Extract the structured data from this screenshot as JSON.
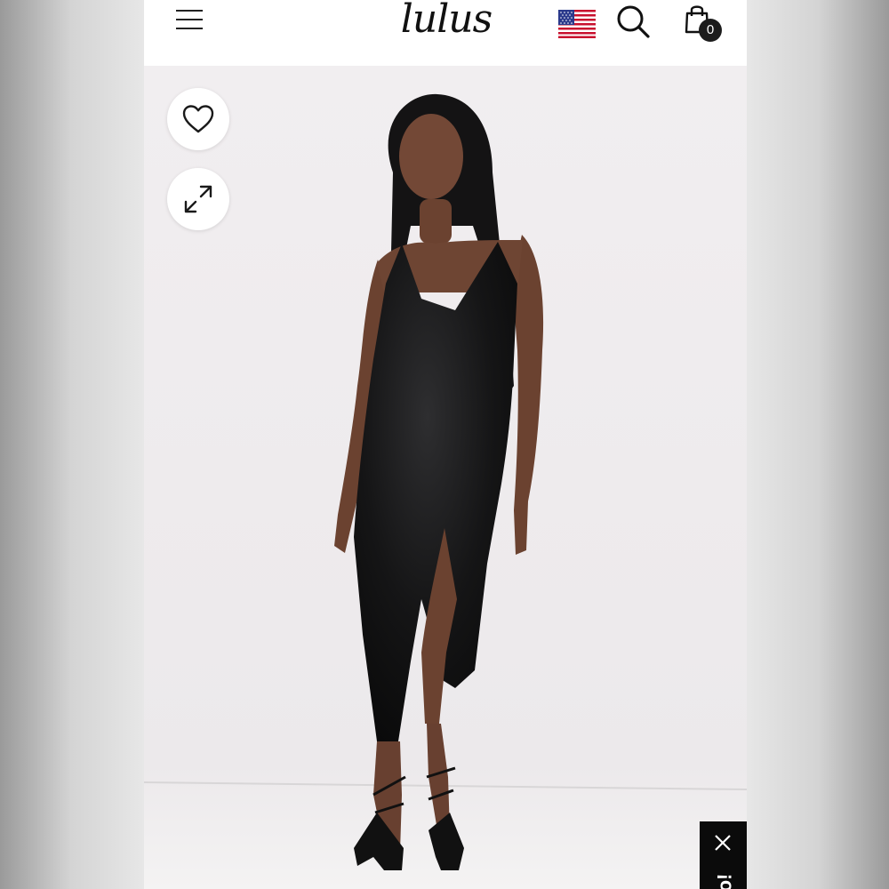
{
  "header": {
    "logo_text": "lulus",
    "cart_count": "0"
  },
  "icons": {
    "menu": "hamburger-menu-icon",
    "flag": "us-flag-icon",
    "search": "search-icon",
    "cart": "shopping-bag-icon",
    "wishlist": "heart-icon",
    "expand": "expand-arrows-icon",
    "close": "close-icon"
  },
  "promo": {
    "text": "o!"
  },
  "colors": {
    "header_bg": "#ffffff",
    "image_bg": "#f1eef0",
    "badge_bg": "#1c1c1c",
    "promo_bg": "#0b0b0b"
  }
}
